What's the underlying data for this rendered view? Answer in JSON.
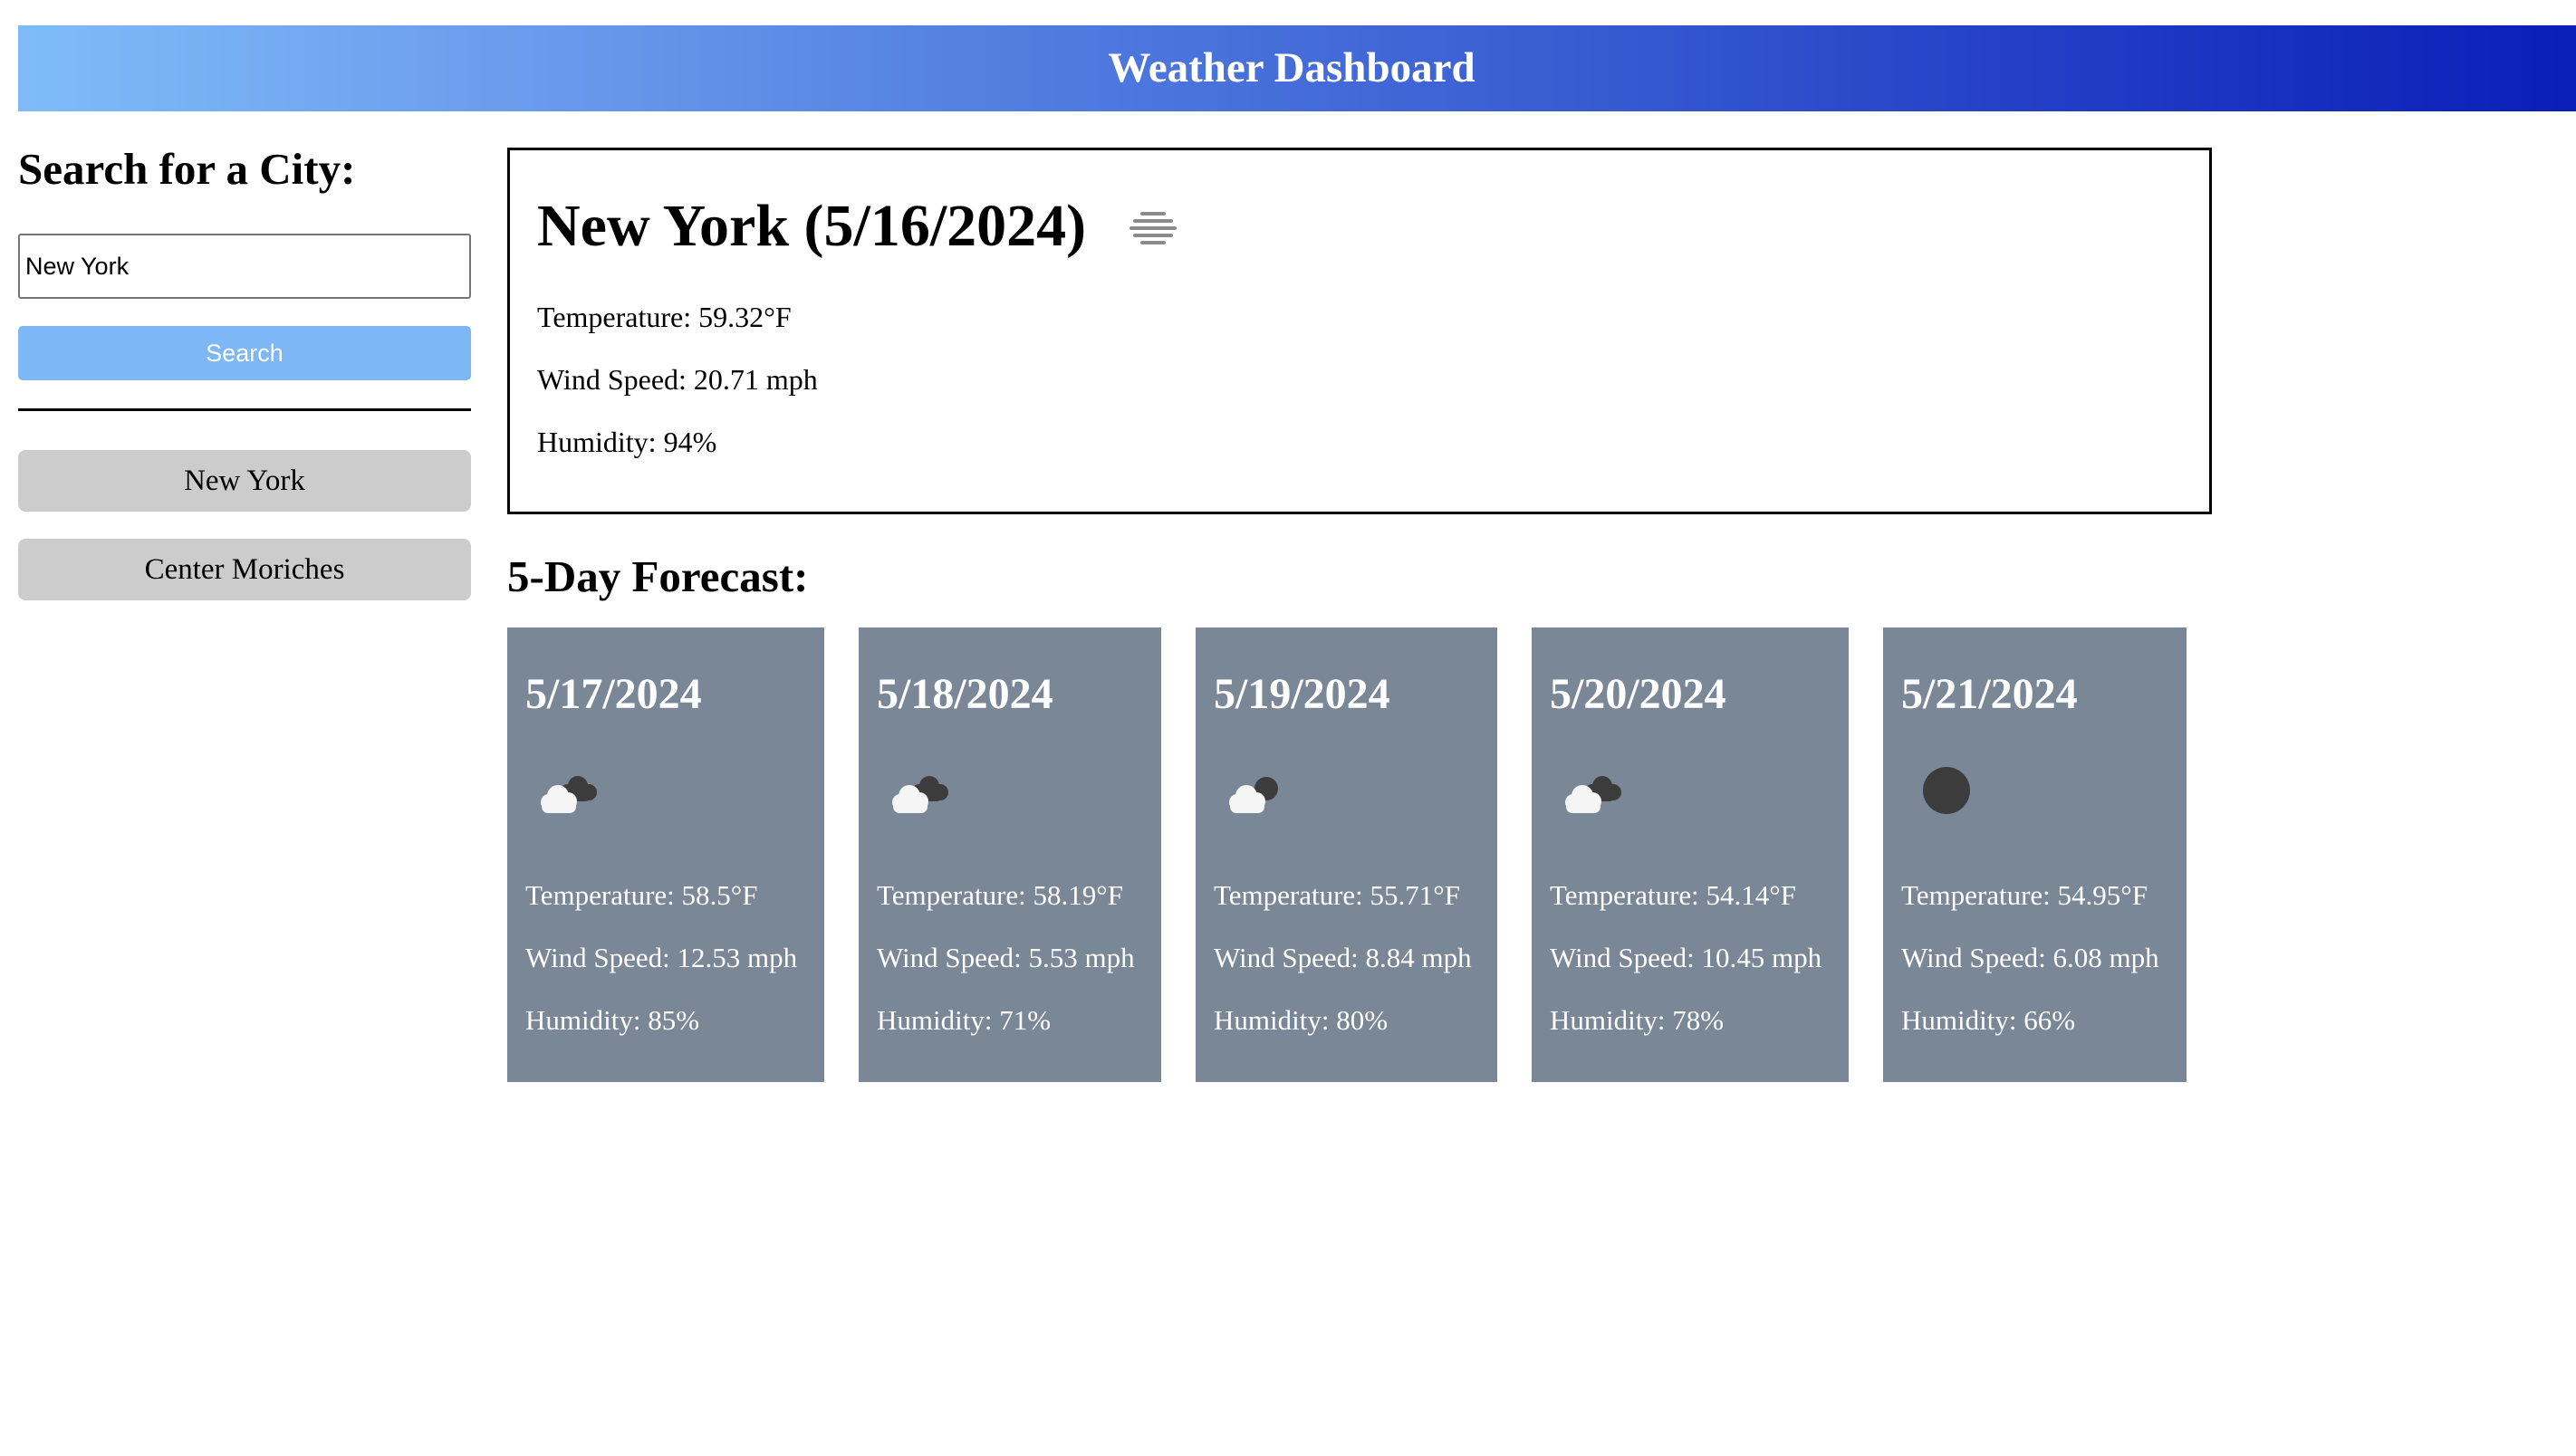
{
  "colors": {
    "header_gradient_start": "#80bbf9",
    "header_gradient_end": "#0a1eb8",
    "search_button_bg": "#7db8f5",
    "history_button_bg": "#cccccc",
    "forecast_card_bg": "#7a8796"
  },
  "header": {
    "title": "Weather Dashboard"
  },
  "sidebar": {
    "heading": "Search for a City:",
    "search_value": "New York",
    "search_button_label": "Search",
    "history": [
      {
        "label": "New York"
      },
      {
        "label": "Center Moriches"
      }
    ]
  },
  "current": {
    "title": "New York (5/16/2024)",
    "icon": "mist-icon",
    "temperature": "Temperature: 59.32°F",
    "wind": "Wind Speed: 20.71 mph",
    "humidity": "Humidity: 94%"
  },
  "forecast": {
    "heading": "5-Day Forecast:",
    "days": [
      {
        "date": "5/17/2024",
        "icon": "broken-clouds-icon",
        "temperature": "Temperature: 58.5°F",
        "wind": "Wind Speed: 12.53 mph",
        "humidity": "Humidity: 85%"
      },
      {
        "date": "5/18/2024",
        "icon": "broken-clouds-icon",
        "temperature": "Temperature: 58.19°F",
        "wind": "Wind Speed: 5.53 mph",
        "humidity": "Humidity: 71%"
      },
      {
        "date": "5/19/2024",
        "icon": "few-clouds-night-icon",
        "temperature": "Temperature: 55.71°F",
        "wind": "Wind Speed: 8.84 mph",
        "humidity": "Humidity: 80%"
      },
      {
        "date": "5/20/2024",
        "icon": "broken-clouds-icon",
        "temperature": "Temperature: 54.14°F",
        "wind": "Wind Speed: 10.45 mph",
        "humidity": "Humidity: 78%"
      },
      {
        "date": "5/21/2024",
        "icon": "clear-night-icon",
        "temperature": "Temperature: 54.95°F",
        "wind": "Wind Speed: 6.08 mph",
        "humidity": "Humidity: 66%"
      }
    ]
  }
}
